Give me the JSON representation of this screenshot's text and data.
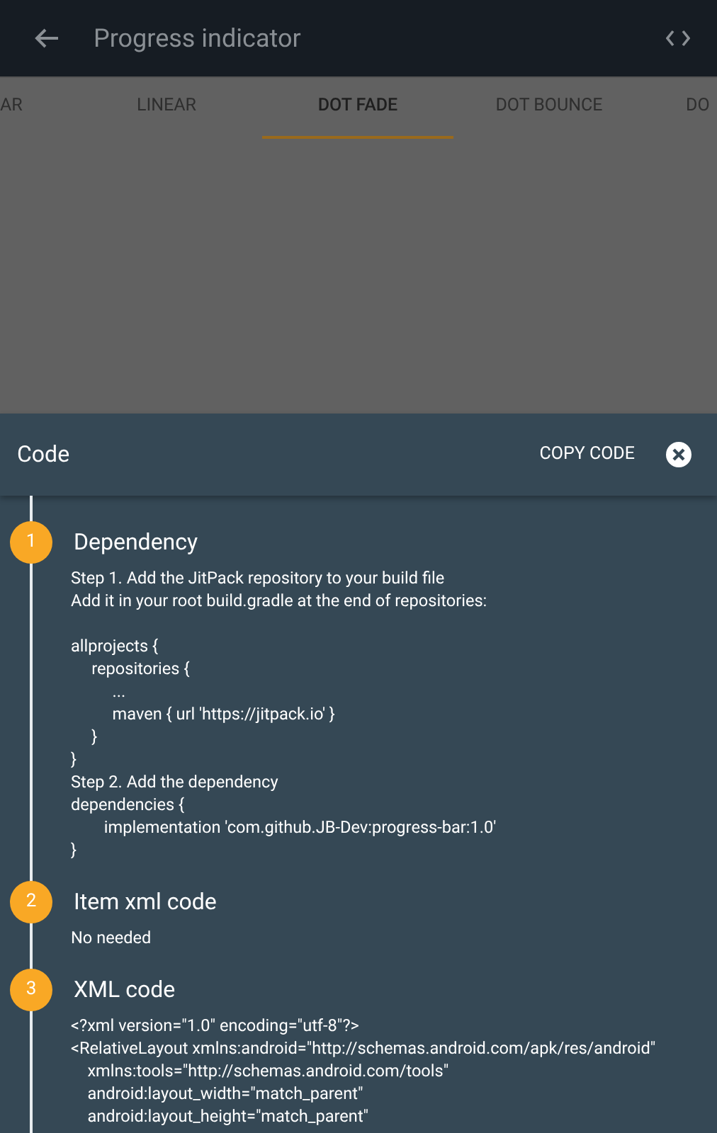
{
  "app_bar": {
    "title": "Progress indicator"
  },
  "tabs": [
    {
      "label": "AR",
      "selected": false
    },
    {
      "label": "LINEAR",
      "selected": false
    },
    {
      "label": "DOT FADE",
      "selected": true
    },
    {
      "label": "DOT BOUNCE",
      "selected": false
    },
    {
      "label": "DO",
      "selected": false
    }
  ],
  "code_sheet": {
    "title": "Code",
    "copy_button": "COPY CODE",
    "steps": [
      {
        "number": "1",
        "title": "Dependency",
        "intro": [
          "Step 1. Add the JitPack repository to your build file",
          "Add it in your root build.gradle at the end of repositories:"
        ],
        "lines": [
          "allprojects {",
          "     repositories {",
          "          ...",
          "          maven { url 'https://jitpack.io' }",
          "     }",
          "}",
          "Step 2. Add the dependency",
          "dependencies {",
          "        implementation 'com.github.JB-Dev:progress-bar:1.0'",
          "}"
        ]
      },
      {
        "number": "2",
        "title": "Item xml code",
        "lines": [
          "No needed"
        ]
      },
      {
        "number": "3",
        "title": "XML code",
        "lines": [
          "<?xml version=\"1.0\" encoding=\"utf-8\"?>",
          "<RelativeLayout xmlns:android=\"http://schemas.android.com/apk/res/android\"",
          "    xmlns:tools=\"http://schemas.android.com/tools\"",
          "    android:layout_width=\"match_parent\"",
          "    android:layout_height=\"match_parent\""
        ]
      }
    ]
  }
}
